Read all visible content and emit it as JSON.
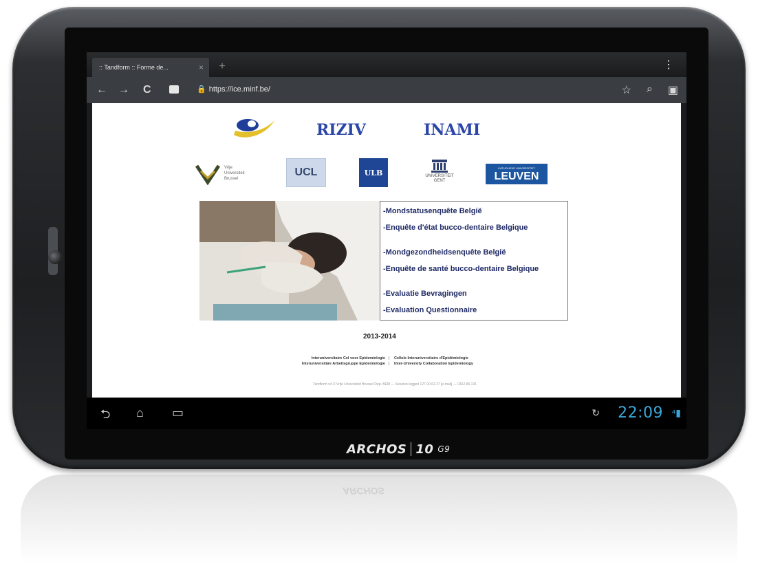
{
  "device": {
    "brand": "ARCHOS",
    "model_number": "10",
    "model_suffix": "G9"
  },
  "browser": {
    "tab_title": ":: Tandform :: Forme de...",
    "tab_close": "×",
    "new_tab": "+",
    "menu": "⋮",
    "back": "←",
    "forward": "→",
    "reload": "C",
    "url": "https://ice.minf.be/",
    "lock": "🔒",
    "star": "☆",
    "search": "⌕",
    "bookmarks": "▣"
  },
  "page": {
    "riziv": "RIZIV",
    "inami": "INAMI",
    "vub_line1": "Vrije",
    "vub_line2": "Universiteit",
    "vub_line3": "Brussel",
    "ucl": "UCL",
    "ulb": "ULB",
    "ugent_line1": "UNIVERSITEIT",
    "ugent_line2": "GENT",
    "leuven_top": "KATHOLIEKE UNIVERSITEIT",
    "leuven": "LEUVEN",
    "menu": [
      "-Mondstatusenquête België",
      "-Enquête d'état bucco-dentaire Belgique",
      "-Mondgezondheidsenquête België",
      "-Enquête de santé bucco-dentaire Belgique",
      "-Evaluatie Bevragingen",
      "-Evaluation Questionnaire"
    ],
    "years": "2013-2014",
    "footer_left_1": "Interuniversitaire Cel voor Epidemiologie",
    "footer_left_2": "Interuniversitäre Arbeitsgruppe Epidemiologie",
    "footer_sep": "|",
    "footer_right_1": "Cellule Interuniversitaire d'Epidémiologie",
    "footer_right_2": "Inter-University Collaboration Epidemiology",
    "footer_bottom": "Tandform v4 © Vrije Universiteit Brussel Dep. BEM — Session logged 127.00.62.37 [e-mail] — 0162.80.131"
  },
  "system": {
    "back": "⮌",
    "home": "⌂",
    "recents": "▭",
    "notification": "↻",
    "time": "22:09",
    "status": "⁴▮"
  },
  "colors": {
    "accent_blue": "#2b45a8",
    "menu_text": "#1f2a66",
    "clock": "#3aa7d8"
  }
}
